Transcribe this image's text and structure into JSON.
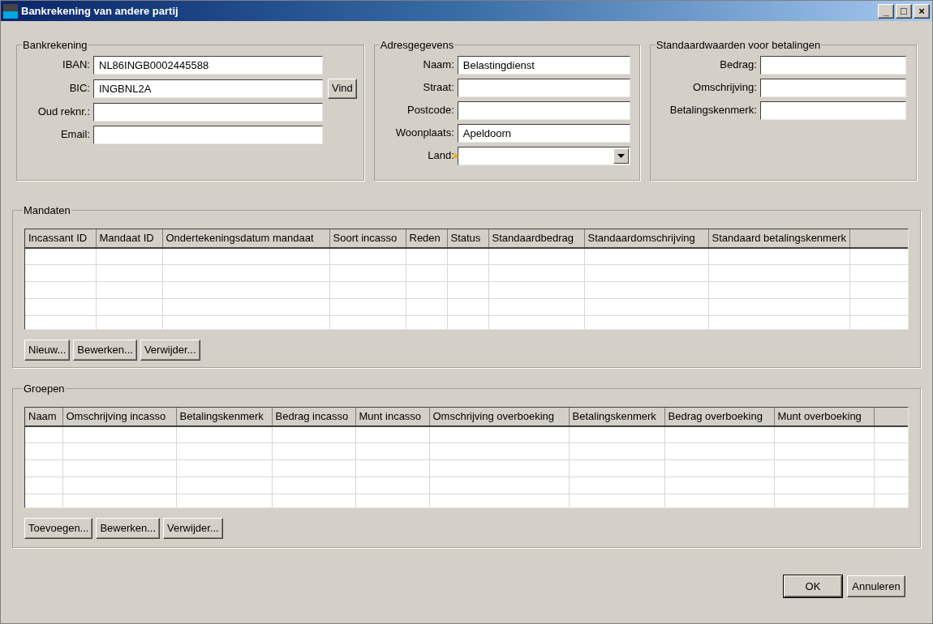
{
  "window": {
    "title": "Bankrekening van andere partij",
    "controls": [
      "_",
      "□",
      "×"
    ]
  },
  "bankrekening": {
    "title": "Bankrekening",
    "fields": [
      {
        "label": "IBAN:",
        "value": "NL86INGB0002445588"
      },
      {
        "label": "BIC:",
        "value": "INGBNL2A",
        "button": "Vind"
      },
      {
        "label": "Oud reknr.:"
      },
      {
        "label": "Email:"
      }
    ]
  },
  "adresgegevens": {
    "title": "Adresgegevens",
    "fields": [
      {
        "label": "Naam:",
        "value": "Belastingdienst",
        "kind": "text"
      },
      {
        "label": "Straat:",
        "kind": "text"
      },
      {
        "label": "Postcode:",
        "kind": "text"
      },
      {
        "label": "Woonplaats:",
        "value": "Apeldoorn",
        "kind": "text"
      },
      {
        "label": "Land:",
        "kind": "dropdown",
        "warning": true
      }
    ]
  },
  "standaardwaarden": {
    "title": "Standaardwaarden voor betalingen",
    "fields": [
      {
        "label": "Bedrag:"
      },
      {
        "label": "Omschrijving:"
      },
      {
        "label": "Betalingskenmerk:"
      }
    ]
  },
  "mandaten": {
    "title": "Mandaten",
    "columns": [
      "Incassant ID",
      "Mandaat ID",
      "Ondertekeningsdatum mandaat",
      "Soort incasso",
      "Reden",
      "Status",
      "Standaardbedrag",
      "Standaardomschrijving",
      "Standaard betalingskenmerk"
    ],
    "buttons": [
      "Nieuw...",
      "Bewerken...",
      "Verwijder..."
    ]
  },
  "groepen": {
    "title": "Groepen",
    "columns": [
      "Naam",
      "Omschrijving incasso",
      "Betalingskenmerk",
      "Bedrag incasso",
      "Munt incasso",
      "Omschrijving overboeking",
      "Betalingskenmerk",
      "Bedrag overboeking",
      "Munt overboeking"
    ],
    "buttons": [
      "Toevoegen...",
      "Bewerken...",
      "Verwijder..."
    ]
  },
  "footer_buttons": [
    "OK",
    "Annuleren"
  ]
}
